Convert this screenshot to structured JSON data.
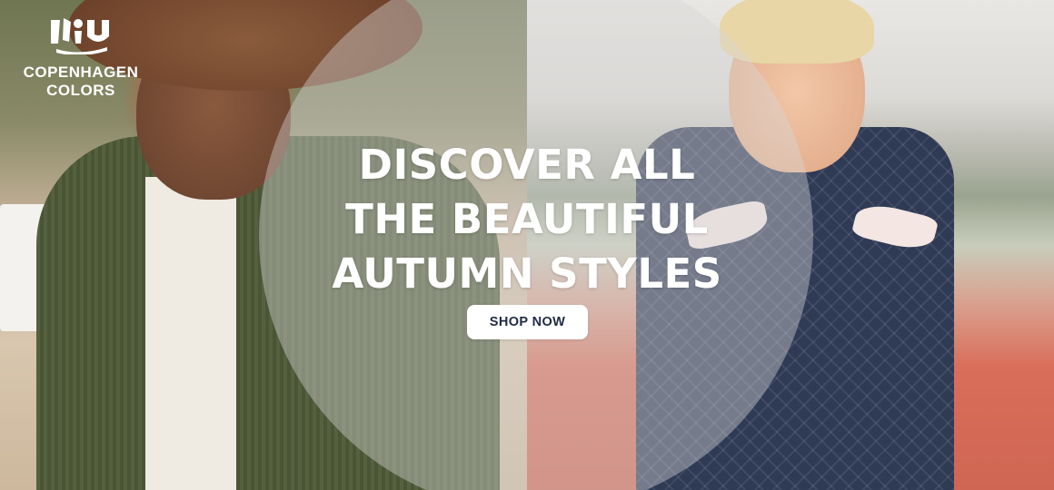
{
  "brand": {
    "logo_icon": "copenhagen-colors-logo-icon",
    "name_line1": "COPENHAGEN",
    "name_line2": "COLORS"
  },
  "hero": {
    "headline_line1": "DISCOVER ALL",
    "headline_line2": "THE BEAUTIFUL",
    "headline_line3": "AUTUMN STYLES",
    "cta_label": "SHOP NOW"
  },
  "colors": {
    "cta_text": "#1f2a44",
    "cta_bg": "#ffffff",
    "headline": "#ffffff",
    "overlay_circle": "rgba(215,215,215,0.42)"
  }
}
